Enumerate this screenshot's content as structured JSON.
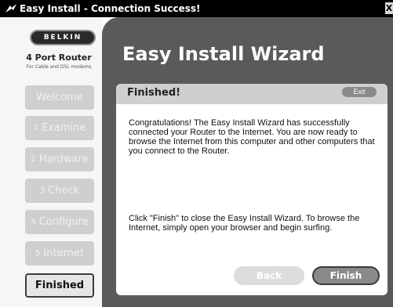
{
  "window": {
    "title": "Easy Install - Connection Success!",
    "close_label": "X"
  },
  "sidebar": {
    "brand": "BELKIN",
    "router_name": "4 Port Router",
    "router_sub": "For Cable and DSL modems",
    "steps": [
      {
        "num": "",
        "label": "Welcome",
        "active": false
      },
      {
        "num": "1",
        "label": "Examine",
        "active": false
      },
      {
        "num": "2",
        "label": "Hardware",
        "active": false
      },
      {
        "num": "3",
        "label": "Check",
        "active": false
      },
      {
        "num": "4",
        "label": "Configure",
        "active": false
      },
      {
        "num": "5",
        "label": "Internet",
        "active": false
      },
      {
        "num": "",
        "label": "Finished",
        "active": true
      }
    ]
  },
  "main": {
    "title": "Easy Install Wizard",
    "panel": {
      "title": "Finished!",
      "exit_label": "Exit",
      "paragraph1": "Congratulations! The Easy Install Wizard has successfully connected your Router to the Internet. You are now ready to browse the Internet from this computer and other computers that you connect to the Router.",
      "paragraph2": "Click \"Finish\" to close the Easy Install Wizard. To browse the Internet, simply open your browser and begin surfing."
    },
    "buttons": {
      "back_label": "Back",
      "finish_label": "Finish"
    }
  },
  "colors": {
    "main_bg": "#5a5a5a",
    "sidebar_bg": "#f6f6f6",
    "step_bg": "#cfcfcf"
  }
}
